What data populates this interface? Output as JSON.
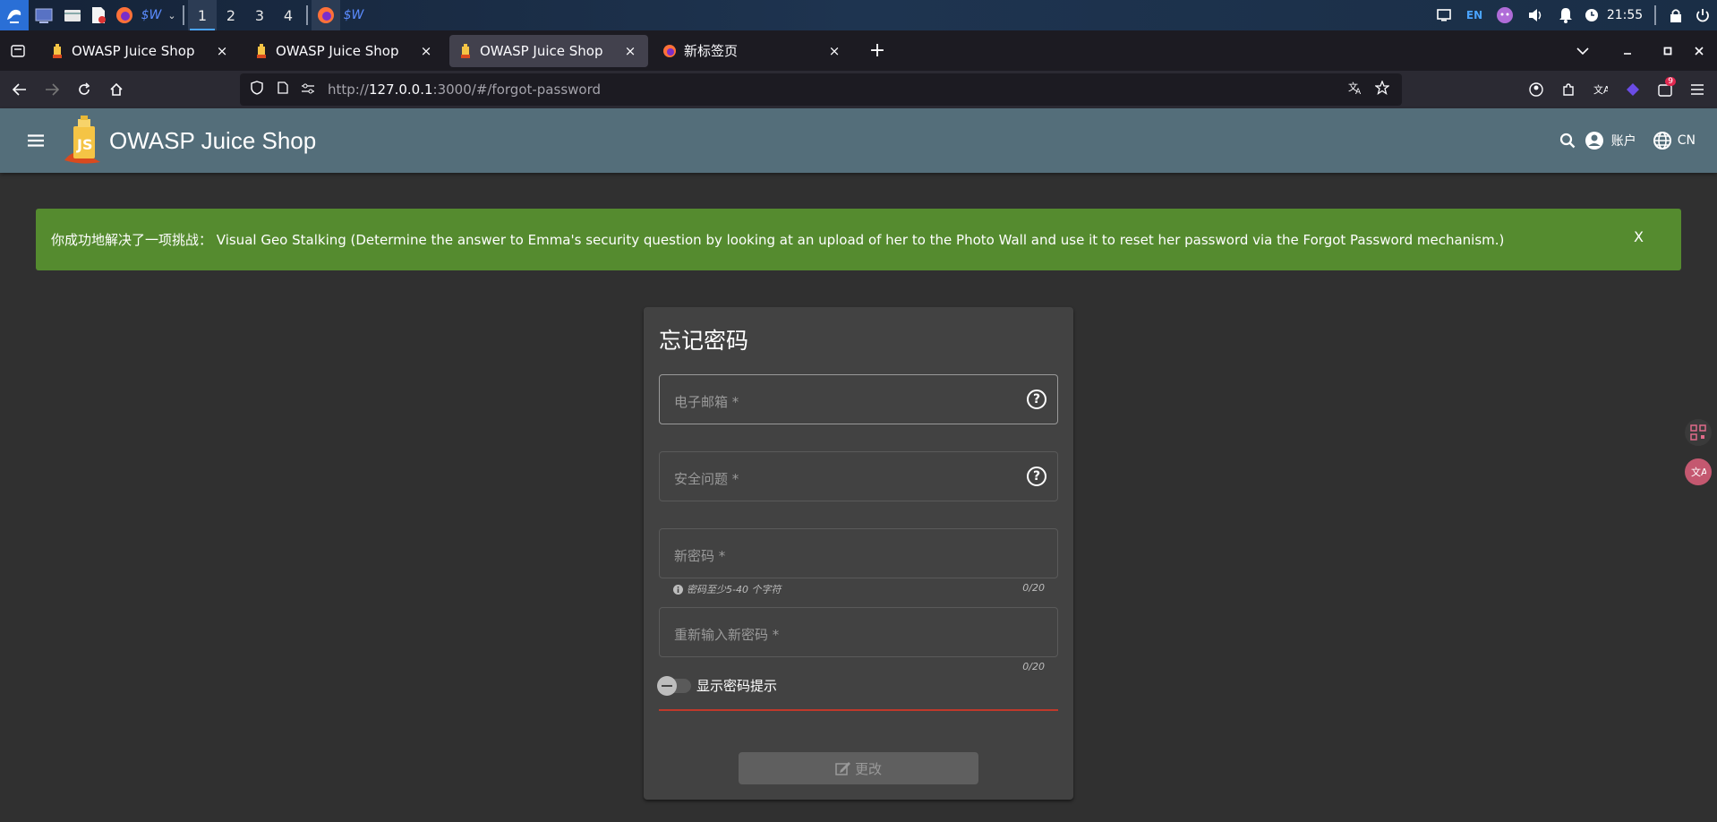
{
  "taskbar": {
    "workspaces": [
      "1",
      "2",
      "3",
      "4"
    ],
    "lang": "EN",
    "time": "21:55"
  },
  "tabs": [
    {
      "label": "OWASP Juice Shop",
      "active": false
    },
    {
      "label": "OWASP Juice Shop",
      "active": false
    },
    {
      "label": "OWASP Juice Shop",
      "active": true
    },
    {
      "label": "新标签页",
      "active": false
    }
  ],
  "tab_new": "+",
  "tab_close": "×",
  "url": {
    "scheme": "http://",
    "host": "127.0.0.1",
    "rest": ":3000/#/forgot-password"
  },
  "extension_badge": "9",
  "app": {
    "title": "OWASP Juice Shop",
    "account_label": "账户",
    "language_label": "CN"
  },
  "banner": {
    "text": "你成功地解决了一项挑战： Visual Geo Stalking (Determine the answer to Emma's security question by looking at an upload of her to the Photo Wall and use it to reset her password via the Forgot Password mechanism.)",
    "close": "X",
    "color": "#558b2f"
  },
  "form": {
    "title": "忘记密码",
    "email_label": "电子邮箱 *",
    "security_label": "安全问题 *",
    "new_password_label": "新密码 *",
    "password_hint": "密码至少5-40 个字符",
    "new_password_count": "0/20",
    "repeat_password_label": "重新输入新密码 *",
    "repeat_password_count": "0/20",
    "show_hint_label": "显示密码提示",
    "submit_label": "更改"
  },
  "colors": {
    "toolbar": "#546e7a",
    "background": "#303030",
    "card": "#424242",
    "error_line": "#c0392b"
  }
}
